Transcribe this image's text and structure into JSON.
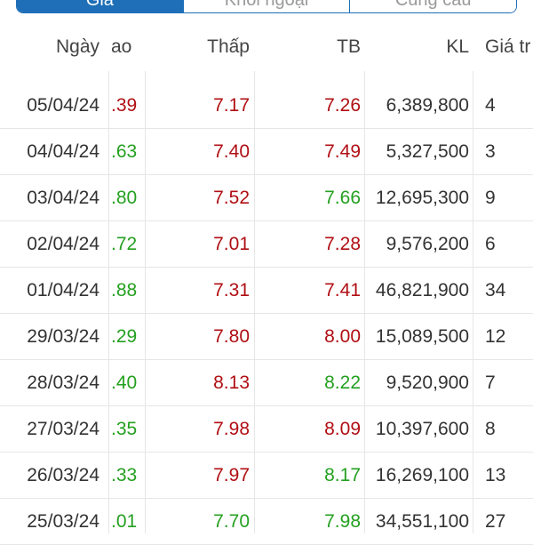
{
  "tabs": [
    {
      "label": "Giá",
      "active": true
    },
    {
      "label": "Khối ngoại",
      "active": false
    },
    {
      "label": "Cung cầu",
      "active": false
    }
  ],
  "columns": {
    "date": "Ngày",
    "high": "ao",
    "low": "Thấp",
    "avg": "TB",
    "volume": "KL",
    "value": "Giá tr"
  },
  "rows": [
    {
      "date": "05/04/24",
      "high": ".39",
      "high_color": "red",
      "low": "7.17",
      "low_color": "red",
      "avg": "7.26",
      "avg_color": "red",
      "volume": "6,389,800",
      "value": "4"
    },
    {
      "date": "04/04/24",
      "high": ".63",
      "high_color": "green",
      "low": "7.40",
      "low_color": "red",
      "avg": "7.49",
      "avg_color": "red",
      "volume": "5,327,500",
      "value": "3"
    },
    {
      "date": "03/04/24",
      "high": ".80",
      "high_color": "green",
      "low": "7.52",
      "low_color": "red",
      "avg": "7.66",
      "avg_color": "green",
      "volume": "12,695,300",
      "value": "9"
    },
    {
      "date": "02/04/24",
      "high": ".72",
      "high_color": "green",
      "low": "7.01",
      "low_color": "red",
      "avg": "7.28",
      "avg_color": "red",
      "volume": "9,576,200",
      "value": "6"
    },
    {
      "date": "01/04/24",
      "high": ".88",
      "high_color": "green",
      "low": "7.31",
      "low_color": "red",
      "avg": "7.41",
      "avg_color": "red",
      "volume": "46,821,900",
      "value": "34"
    },
    {
      "date": "29/03/24",
      "high": ".29",
      "high_color": "green",
      "low": "7.80",
      "low_color": "red",
      "avg": "8.00",
      "avg_color": "red",
      "volume": "15,089,500",
      "value": "12"
    },
    {
      "date": "28/03/24",
      "high": ".40",
      "high_color": "green",
      "low": "8.13",
      "low_color": "red",
      "avg": "8.22",
      "avg_color": "green",
      "volume": "9,520,900",
      "value": "7"
    },
    {
      "date": "27/03/24",
      "high": ".35",
      "high_color": "green",
      "low": "7.98",
      "low_color": "red",
      "avg": "8.09",
      "avg_color": "red",
      "volume": "10,397,600",
      "value": "8"
    },
    {
      "date": "26/03/24",
      "high": ".33",
      "high_color": "green",
      "low": "7.97",
      "low_color": "red",
      "avg": "8.17",
      "avg_color": "green",
      "volume": "16,269,100",
      "value": "13"
    },
    {
      "date": "25/03/24",
      "high": ".01",
      "high_color": "green",
      "low": "7.70",
      "low_color": "green",
      "avg": "7.98",
      "avg_color": "green",
      "volume": "34,551,100",
      "value": "27"
    }
  ],
  "colors": {
    "red": "#b00f14",
    "green": "#24a020",
    "accent": "#1e6fb7"
  }
}
